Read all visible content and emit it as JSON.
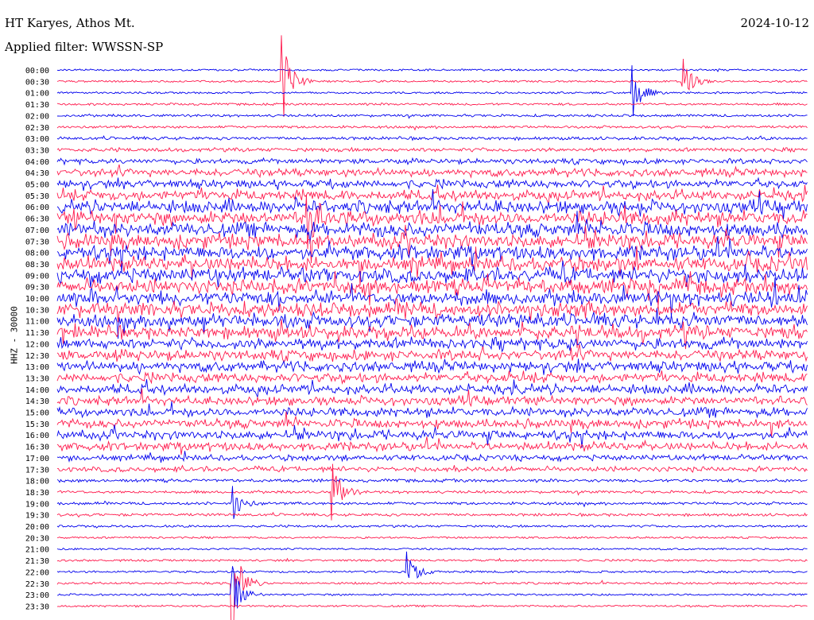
{
  "header": {
    "station": "HT Karyes, Athos Mt.",
    "date": "2024-10-12",
    "filter": "Applied filter: WWSSN-SP"
  },
  "channel_label": "HHZ - 30000",
  "colors": {
    "blue": "#0000ee",
    "red": "#ff1a4d"
  },
  "chart_data": {
    "type": "line",
    "title": "HT Karyes, Athos Mt.",
    "subtitle": "Applied filter: WWSSN-SP",
    "date": "2024-10-12",
    "ylabel": "HHZ - 30000",
    "row_labels": [
      "00:00",
      "00:30",
      "01:00",
      "01:30",
      "02:00",
      "02:30",
      "03:00",
      "03:30",
      "04:00",
      "04:30",
      "05:00",
      "05:30",
      "06:00",
      "06:30",
      "07:00",
      "07:30",
      "08:00",
      "08:30",
      "09:00",
      "09:30",
      "10:00",
      "10:30",
      "11:00",
      "11:30",
      "12:00",
      "12:30",
      "13:00",
      "13:30",
      "14:00",
      "14:30",
      "15:00",
      "15:30",
      "16:00",
      "16:30",
      "17:00",
      "17:30",
      "18:00",
      "18:30",
      "19:00",
      "19:30",
      "20:00",
      "20:30",
      "21:00",
      "21:30",
      "22:00",
      "22:30",
      "23:00",
      "23:30"
    ],
    "row_colors": [
      "blue",
      "red"
    ],
    "activity_level": [
      0.05,
      0.05,
      0.05,
      0.08,
      0.1,
      0.1,
      0.15,
      0.2,
      0.3,
      0.5,
      0.55,
      0.7,
      0.9,
      1.0,
      1.0,
      1.0,
      1.0,
      1.0,
      1.0,
      1.0,
      1.0,
      1.0,
      0.95,
      0.85,
      0.75,
      0.7,
      0.7,
      0.65,
      0.65,
      0.6,
      0.6,
      0.6,
      0.6,
      0.55,
      0.35,
      0.3,
      0.15,
      0.12,
      0.12,
      0.12,
      0.08,
      0.05,
      0.05,
      0.06,
      0.07,
      0.07,
      0.05,
      0.05
    ],
    "events": [
      {
        "row": 1,
        "minute": 9,
        "amp": 5
      },
      {
        "row": 2,
        "minute": 23,
        "amp": 3
      },
      {
        "row": 1,
        "minute": 25,
        "amp": 2.5
      },
      {
        "row": 13,
        "minute": 10,
        "amp": 4
      },
      {
        "row": 37,
        "minute": 11,
        "amp": 3
      },
      {
        "row": 38,
        "minute": 7,
        "amp": 2
      },
      {
        "row": 44,
        "minute": 14,
        "amp": 2
      },
      {
        "row": 45,
        "minute": 7,
        "amp": 5
      },
      {
        "row": 46,
        "minute": 7,
        "amp": 3
      }
    ]
  }
}
